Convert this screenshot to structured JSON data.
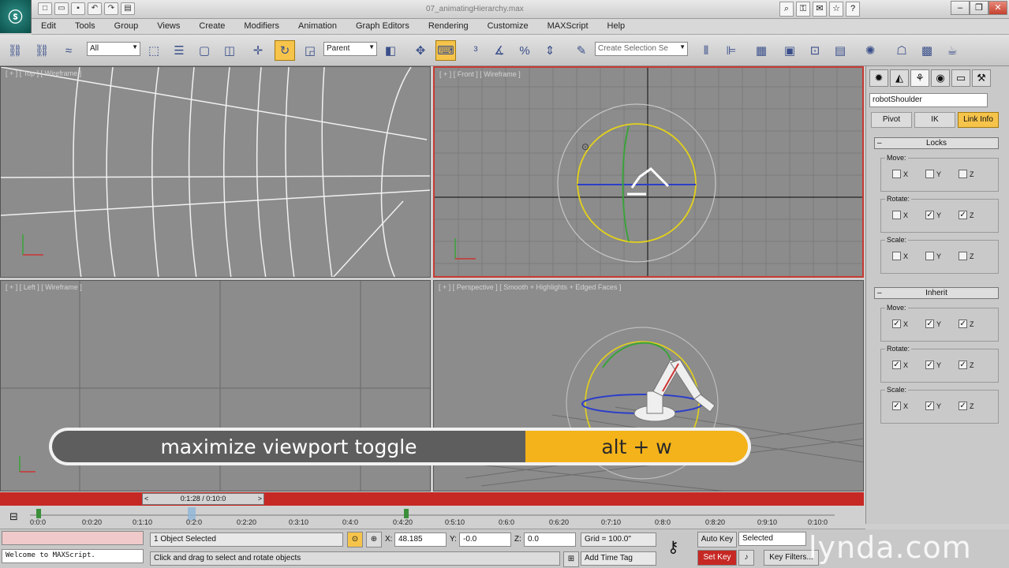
{
  "window": {
    "title": "07_animatingHierarchy.max",
    "info_center": [
      "?",
      "☆",
      "?"
    ]
  },
  "menu": [
    "Edit",
    "Tools",
    "Group",
    "Views",
    "Create",
    "Modifiers",
    "Animation",
    "Graph Editors",
    "Rendering",
    "Customize",
    "MAXScript",
    "Help"
  ],
  "toolbar": {
    "selection_filter": "All",
    "reference_coord": "Parent",
    "named_selection_placeholder": "Create Selection Se"
  },
  "viewports": {
    "top": "[ + ] [ Top ] [ Wireframe ]",
    "front": "[ + ] [ Front ] [ Wireframe ]",
    "left": "[ + ] [ Left ] [ Wireframe ]",
    "perspective": "[ + ] [ Perspective ] [ Smooth + Highlights + Edged Faces ]"
  },
  "command_panel": {
    "object_name": "robotShoulder",
    "sub_tabs": [
      "Pivot",
      "IK",
      "Link Info"
    ],
    "locks": {
      "header": "Locks",
      "move": {
        "label": "Move:",
        "x": "X",
        "y": "Y",
        "z": "Z",
        "checked": [
          false,
          false,
          false
        ]
      },
      "rotate": {
        "label": "Rotate:",
        "x": "X",
        "y": "Y",
        "z": "Z",
        "checked": [
          false,
          true,
          true
        ]
      },
      "scale": {
        "label": "Scale:",
        "x": "X",
        "y": "Y",
        "z": "Z",
        "checked": [
          false,
          false,
          false
        ]
      }
    },
    "inherit": {
      "header": "Inherit",
      "move": {
        "label": "Move:",
        "x": "X",
        "y": "Y",
        "z": "Z",
        "checked": [
          true,
          true,
          true
        ]
      },
      "rotate": {
        "label": "Rotate:",
        "x": "X",
        "y": "Y",
        "z": "Z",
        "checked": [
          true,
          true,
          true
        ]
      },
      "scale": {
        "label": "Scale:",
        "x": "X",
        "y": "Y",
        "z": "Z",
        "checked": [
          true,
          true,
          true
        ]
      }
    }
  },
  "time_slider": {
    "value": "0:1:28 / 0:10:0",
    "prev": "<",
    "next": ">"
  },
  "track_ticks": [
    "0:0:0",
    "0:0:20",
    "0:1:10",
    "0:2:0",
    "0:2:20",
    "0:3:10",
    "0:4:0",
    "0:4:20",
    "0:5:10",
    "0:6:0",
    "0:6:20",
    "0:7:10",
    "0:8:0",
    "0:8:20",
    "0:9:10",
    "0:10:0"
  ],
  "status": {
    "maxscript_listener": "Welcome to MAXScript.",
    "selection": "1 Object Selected",
    "prompt": "Click and drag to select and rotate objects",
    "x_label": "X:",
    "x_value": "48.185",
    "y_label": "Y:",
    "y_value": "-0.0",
    "z_label": "Z:",
    "z_value": "0.0",
    "grid": "Grid = 100.0\"",
    "add_time_tag": "Add Time Tag",
    "auto_key": "Auto Key",
    "set_key": "Set Key",
    "key_mode": "Selected",
    "key_filters": "Key Filters..."
  },
  "overlay": {
    "action": "maximize viewport toggle",
    "shortcut": "alt + w"
  },
  "watermark": "lynda.com"
}
